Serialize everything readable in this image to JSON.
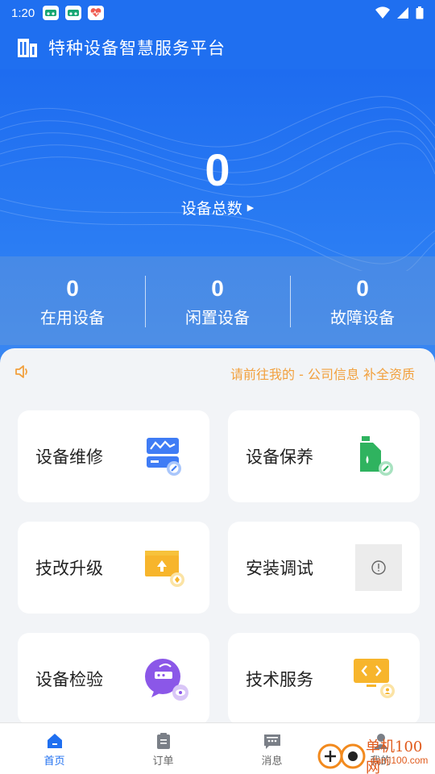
{
  "status_bar": {
    "time": "1:20",
    "notification_icons": [
      "app-notification-icon",
      "app-notification-icon",
      "health-app-icon"
    ],
    "right_icons": [
      "wifi-icon",
      "signal-icon",
      "battery-icon"
    ]
  },
  "header": {
    "title": "特种设备智慧服务平台",
    "icon": "building-icon"
  },
  "hero": {
    "total_value": "0",
    "total_label": "设备总数",
    "total_arrow": "▶"
  },
  "stats": [
    {
      "value": "0",
      "label": "在用设备"
    },
    {
      "value": "0",
      "label": "闲置设备"
    },
    {
      "value": "0",
      "label": "故障设备"
    }
  ],
  "notice": {
    "icon": "speaker-icon",
    "text": "请前往我的 - 公司信息 补全资质"
  },
  "services": [
    {
      "label": "设备维修",
      "icon": "repair-monitor-icon"
    },
    {
      "label": "设备保养",
      "icon": "oil-can-icon"
    },
    {
      "label": "技改升级",
      "icon": "upgrade-box-icon"
    },
    {
      "label": "安装调试",
      "icon": "image-placeholder-icon"
    },
    {
      "label": "设备检验",
      "icon": "inspection-chat-icon"
    },
    {
      "label": "技术服务",
      "icon": "code-monitor-icon"
    }
  ],
  "bottom_nav": [
    {
      "label": "首页",
      "icon": "home-icon",
      "active": true
    },
    {
      "label": "订单",
      "icon": "clipboard-icon",
      "active": false
    },
    {
      "label": "消息",
      "icon": "message-icon",
      "active": false
    },
    {
      "label": "我的",
      "icon": "user-icon",
      "active": false
    }
  ],
  "watermark": {
    "line1": "单机100网",
    "line2": "danji100.com"
  },
  "colors": {
    "primary": "#1f6ff0",
    "notice": "#f2a03d",
    "background": "#f2f4f7"
  }
}
